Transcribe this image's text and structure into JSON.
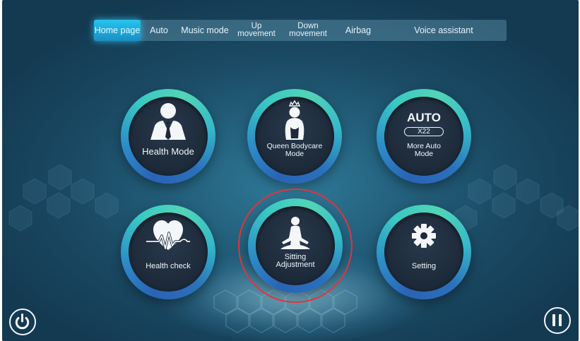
{
  "nav": {
    "items": [
      {
        "label": "Home page",
        "active": true
      },
      {
        "label": "Auto",
        "active": false
      },
      {
        "label": "Music mode",
        "active": false
      },
      {
        "label": "Up\nmovement",
        "active": false
      },
      {
        "label": "Down\nmovement",
        "active": false
      },
      {
        "label": "Airbag",
        "active": false
      },
      {
        "label": "Voice assistant",
        "active": false
      }
    ]
  },
  "modes": {
    "health_mode": {
      "label": "Health Mode",
      "icon": "businessman-icon"
    },
    "queen_bodycare": {
      "label": "Queen Bodycare\nMode",
      "icon": "queen-icon"
    },
    "more_auto": {
      "title": "AUTO",
      "badge": "X22",
      "label": "More Auto\nMode",
      "icon": "auto-badge-icon"
    },
    "health_check": {
      "label": "Health check",
      "icon": "heart-pulse-icon"
    },
    "sitting_adjustment": {
      "label": "Sitting\nAdjustment",
      "icon": "meditation-icon",
      "highlighted": true
    },
    "setting": {
      "label": "Setting",
      "icon": "gear-icon"
    }
  },
  "controls": {
    "power_icon": "power-icon",
    "pause_icon": "pause-icon"
  },
  "colors": {
    "highlight": "#e0353a",
    "active_tab": "#22aee0",
    "ring_teal": "#39c9c4",
    "ring_blue": "#2a63b5"
  }
}
